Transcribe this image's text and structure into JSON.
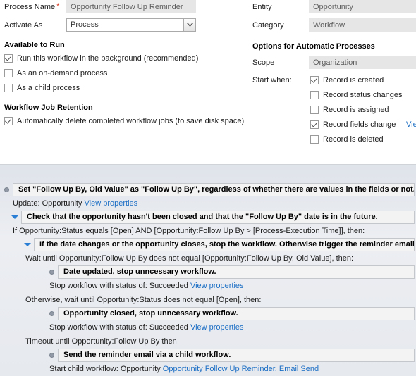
{
  "form": {
    "left": {
      "process_name": {
        "label": "Process Name",
        "required_marker": "*",
        "value": "Opportunity Follow Up Reminder"
      },
      "activate_as": {
        "label": "Activate As",
        "value": "Process",
        "arrow_icon": "chevron-down-icon"
      },
      "available_to_run": {
        "heading": "Available to Run",
        "options": [
          {
            "label": "Run this workflow in the background (recommended)",
            "checked": true
          },
          {
            "label": "As an on-demand process",
            "checked": false
          },
          {
            "label": "As a child process",
            "checked": false
          }
        ]
      },
      "job_retention": {
        "heading": "Workflow Job Retention",
        "options": [
          {
            "label": "Automatically delete completed workflow jobs (to save disk space)",
            "checked": true
          }
        ]
      }
    },
    "right": {
      "entity": {
        "label": "Entity",
        "value": "Opportunity"
      },
      "category": {
        "label": "Category",
        "value": "Workflow"
      },
      "automatic_processes": {
        "heading": "Options for Automatic Processes",
        "scope": {
          "label": "Scope",
          "value": "Organization"
        },
        "start_when": {
          "label": "Start when:",
          "options": [
            {
              "label": "Record is created",
              "checked": true,
              "link": ""
            },
            {
              "label": "Record status changes",
              "checked": false,
              "link": ""
            },
            {
              "label": "Record is assigned",
              "checked": false,
              "link": ""
            },
            {
              "label": "Record fields change",
              "checked": true,
              "link": "View"
            },
            {
              "label": "Record is deleted",
              "checked": false,
              "link": ""
            }
          ]
        }
      }
    }
  },
  "steps": [
    {
      "marker": "bullet",
      "indent": 0,
      "title": "Set \"Follow Up By, Old Value\" as \"Follow Up By\", regardless of whether there are values in the fields or not.",
      "desc_prefix": "Update:  Opportunity ",
      "desc_link": "View properties",
      "desc_suffix": ""
    },
    {
      "marker": "triangle",
      "indent": 1,
      "title": "Check that the opportunity hasn't been closed and that the \"Follow Up By\" date is in the future.",
      "desc_prefix": "If Opportunity:Status equals [Open] AND [Opportunity:Follow Up By > [Process-Execution Time]], then:",
      "desc_link": "",
      "desc_suffix": ""
    },
    {
      "marker": "triangle",
      "indent": 2,
      "title": "If the date changes or the opportunity closes, stop the workflow. Otherwise trigger the reminder email workflow.",
      "desc_prefix": "Wait until Opportunity:Follow Up By does not equal [Opportunity:Follow Up By, Old Value], then:",
      "desc_link": "",
      "desc_suffix": ""
    },
    {
      "marker": "bullet",
      "indent": 3,
      "title": "Date updated, stop unncessary workflow.",
      "desc_prefix": "Stop workflow with status of:  Succeeded ",
      "desc_link": "View properties",
      "desc_suffix": ""
    },
    {
      "marker": "none",
      "indent": 2,
      "title": "",
      "desc_prefix": "Otherwise, wait until Opportunity:Status does not equal [Open], then:",
      "desc_link": "",
      "desc_suffix": ""
    },
    {
      "marker": "bullet",
      "indent": 3,
      "title": "Opportunity closed, stop unncessary workflow.",
      "desc_prefix": "Stop workflow with status of:  Succeeded ",
      "desc_link": "View properties",
      "desc_suffix": ""
    },
    {
      "marker": "none",
      "indent": 2,
      "title": "",
      "desc_prefix": "Timeout until Opportunity:Follow Up By then",
      "desc_link": "",
      "desc_suffix": ""
    },
    {
      "marker": "bullet",
      "indent": 3,
      "title": "Send the reminder email via a child workflow.",
      "desc_prefix": "Start child workflow:  Opportunity ",
      "desc_link": "Opportunity Follow Up Reminder, Email Send",
      "desc_suffix": ""
    }
  ],
  "colors": {
    "required_star": "#d63b21",
    "link": "#1a6dc4",
    "triangle": "#2a7fd4",
    "bullet": "#9099a5",
    "readonly_field_bg": "#e6e6e6"
  }
}
